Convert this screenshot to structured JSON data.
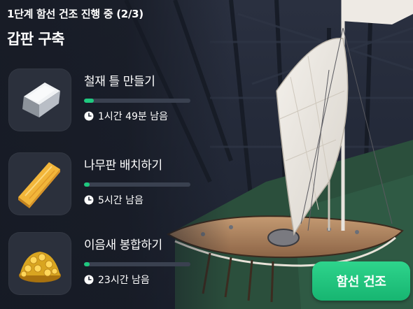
{
  "header": {
    "stage_title": "1단계 함선 건조 진행 중 (2/3)",
    "section_title": "갑판 구축"
  },
  "tasks": [
    {
      "icon": "iron-ingot-icon",
      "name": "철재 틀 만들기",
      "progress": 0.09,
      "remaining": "1시간 49분 남음"
    },
    {
      "icon": "wood-plank-icon",
      "name": "나무판 배치하기",
      "progress": 0.05,
      "remaining": "5시간 남음"
    },
    {
      "icon": "gold-coins-icon",
      "name": "이음새 봉합하기",
      "progress": 0.05,
      "remaining": "23시간 남음"
    }
  ],
  "build_button": {
    "label": "함선 건조"
  },
  "colors": {
    "accent": "#1fc97f",
    "panel": "#2b303c",
    "track": "#3a4150"
  }
}
